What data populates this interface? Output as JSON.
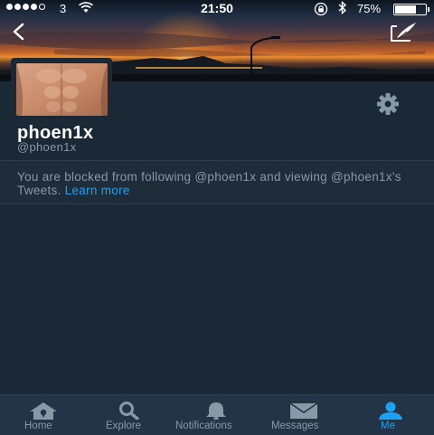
{
  "status_bar": {
    "carrier": "3",
    "time": "21:50",
    "battery_percent": "75%",
    "battery_level": 0.75,
    "signal_bars_filled": 4,
    "signal_bars_total": 5
  },
  "header": {
    "back_icon": "chevron-left-icon",
    "compose_icon": "edit-icon"
  },
  "profile": {
    "display_name": "phoen1x",
    "handle": "@phoen1x",
    "settings_icon": "gear-icon"
  },
  "blocked_notice": {
    "message": "You are blocked from following @phoen1x and viewing @phoen1x's Tweets.",
    "link_text": "Learn more"
  },
  "tab_bar": {
    "active_tab": "Me",
    "tabs": [
      {
        "label": "Home",
        "icon": "home-icon"
      },
      {
        "label": "Explore",
        "icon": "search-icon"
      },
      {
        "label": "Notifications",
        "icon": "bell-icon"
      },
      {
        "label": "Messages",
        "icon": "envelope-icon"
      },
      {
        "label": "Me",
        "icon": "person-icon"
      }
    ]
  },
  "colors": {
    "background": "#1b2836",
    "tab_bar": "#243447",
    "accent": "#1da1f2",
    "muted_text": "#8899a6"
  }
}
